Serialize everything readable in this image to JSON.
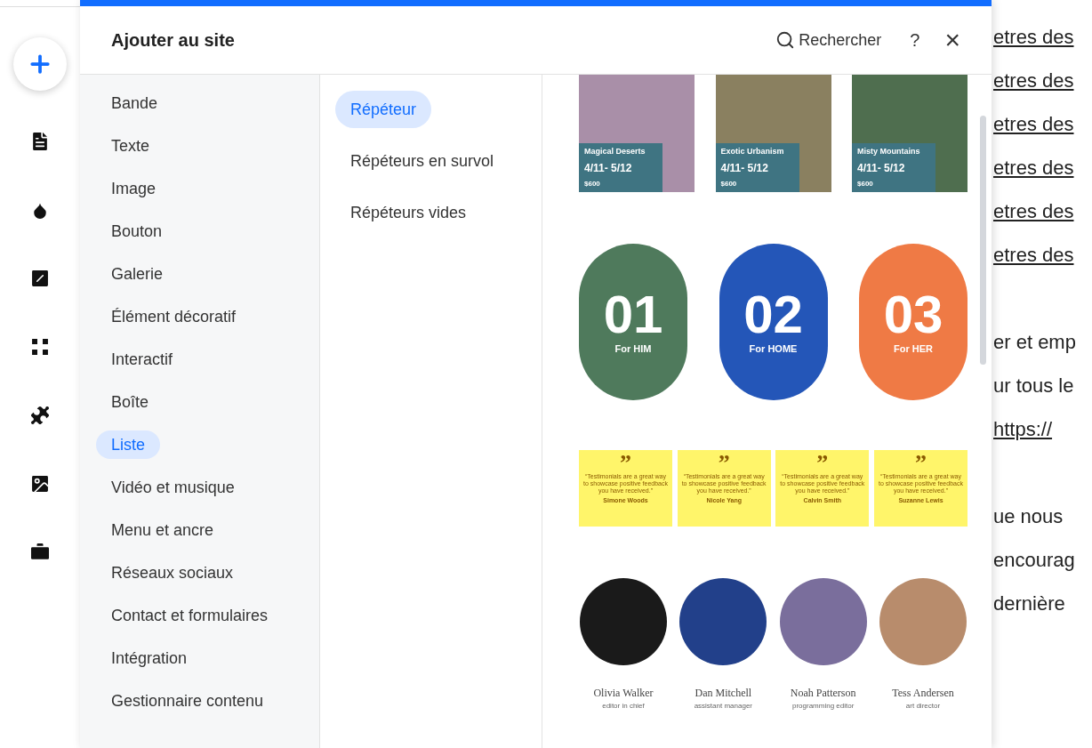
{
  "rail": [
    {
      "kind": "add"
    },
    {
      "kind": "page"
    },
    {
      "kind": "theme"
    },
    {
      "kind": "contrast"
    },
    {
      "kind": "apps"
    },
    {
      "kind": "puzzle"
    },
    {
      "kind": "image"
    },
    {
      "kind": "bag"
    }
  ],
  "panel": {
    "title": "Ajouter au site",
    "search": "Rechercher",
    "help": "?",
    "close": "×"
  },
  "categories": [
    {
      "label": "Bande",
      "selected": false
    },
    {
      "label": "Texte",
      "selected": false
    },
    {
      "label": "Image",
      "selected": false
    },
    {
      "label": "Bouton",
      "selected": false
    },
    {
      "label": "Galerie",
      "selected": false
    },
    {
      "label": "Élément décoratif",
      "selected": false
    },
    {
      "label": "Interactif",
      "selected": false
    },
    {
      "label": "Boîte",
      "selected": false
    },
    {
      "label": "Liste",
      "selected": true
    },
    {
      "label": "Vidéo et musique",
      "selected": false
    },
    {
      "label": "Menu et ancre",
      "selected": false
    },
    {
      "label": "Réseaux sociaux",
      "selected": false
    },
    {
      "label": "Contact et formulaires",
      "selected": false
    },
    {
      "label": "Intégration",
      "selected": false
    },
    {
      "label": "Gestionnaire contenu",
      "selected": false
    }
  ],
  "subcategories": [
    {
      "label": "Répéteur",
      "selected": true
    },
    {
      "label": "Répéteurs en survol",
      "selected": false
    },
    {
      "label": "Répéteurs vides",
      "selected": false
    }
  ],
  "travel_cards": [
    {
      "title": "Magical Deserts",
      "dates": "4/11- 5/12",
      "price": "$600",
      "color": "#a98fa8"
    },
    {
      "title": "Exotic Urbanism",
      "dates": "4/11- 5/12",
      "price": "$600",
      "color": "#8a8060"
    },
    {
      "title": "Misty Mountains",
      "dates": "4/11- 5/12",
      "price": "$600",
      "color": "#4f6e4f"
    }
  ],
  "product_cards": [
    {
      "number": "01",
      "label": "For HIM",
      "color": "#4f7a5c"
    },
    {
      "number": "02",
      "label": "For HOME",
      "color": "#2456b8"
    },
    {
      "number": "03",
      "label": "For HER",
      "color": "#ef7a45"
    }
  ],
  "testimonials": [
    {
      "mark": "”",
      "quote": "“Testimonials are a great way to showcase positive feedback you have received.”",
      "name": "Simone Woods"
    },
    {
      "mark": "”",
      "quote": "“Testimonials are a great way to showcase positive feedback you have received.”",
      "name": "Nicole Yang"
    },
    {
      "mark": "”",
      "quote": "“Testimonials are a great way to showcase positive feedback you have received.”",
      "name": "Calvin Smith"
    },
    {
      "mark": "”",
      "quote": "“Testimonials are a great way to showcase positive feedback you have received.”",
      "name": "Suzanne Lewis"
    }
  ],
  "team": [
    {
      "name": "Olivia Walker",
      "role": "editor in chief",
      "color": "#1a1a1a"
    },
    {
      "name": "Dan Mitchell",
      "role": "assistant manager",
      "color": "#22408a"
    },
    {
      "name": "Noah Patterson",
      "role": "programming editor",
      "color": "#7a6e9c"
    },
    {
      "name": "Tess Andersen",
      "role": "art director",
      "color": "#b88c6c"
    }
  ],
  "background_lines": [
    {
      "text": "etres des",
      "link": true
    },
    {
      "text": "etres des",
      "link": true
    },
    {
      "text": "etres des",
      "link": true
    },
    {
      "text": "etres des",
      "link": true
    },
    {
      "text": "etres des",
      "link": true
    },
    {
      "text": "etres des",
      "link": true
    },
    {
      "text": "er et emp",
      "link": false
    },
    {
      "text": "ur tous le",
      "link": false
    },
    {
      "text": "https://",
      "link": true
    },
    {
      "text": "ue nous",
      "link": false
    },
    {
      "text": "encourag",
      "link": false
    },
    {
      "text": "dernière",
      "link": false
    }
  ]
}
